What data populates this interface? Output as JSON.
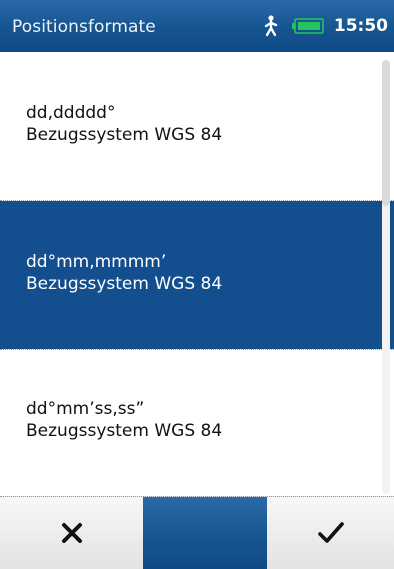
{
  "status_bar": {
    "title": "Positionsformate",
    "time": "15:50",
    "icons": [
      "pedestrian-mode-icon",
      "battery-icon"
    ],
    "battery_color": "#22c55e"
  },
  "list": {
    "items": [
      {
        "format": "dd,ddddd°",
        "datum": "Bezugssystem WGS 84",
        "selected": false
      },
      {
        "format": "dd°mm,mmmm’",
        "datum": "Bezugssystem WGS 84",
        "selected": true
      },
      {
        "format": "dd°mm’ss,ss”",
        "datum": "Bezugssystem WGS 84",
        "selected": false
      }
    ]
  },
  "toolbar": {
    "cancel_icon": "close-icon",
    "confirm_icon": "checkmark-icon"
  },
  "colors": {
    "accent": "#134f8f",
    "header_top": "#2a6aa8"
  }
}
